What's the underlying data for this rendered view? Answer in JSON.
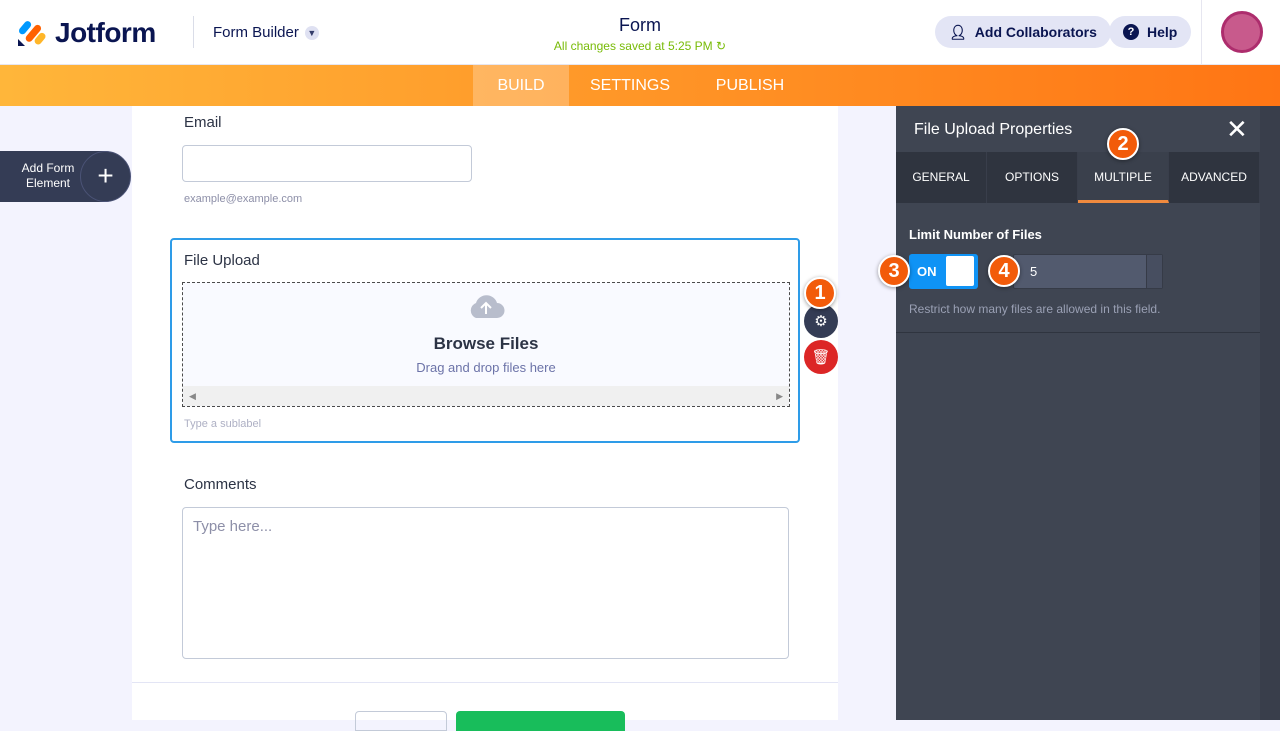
{
  "header": {
    "brand": "Jotform",
    "app_switch": "Form Builder",
    "form_title": "Form",
    "save_status": "All changes saved at 5:25 PM",
    "add_collaborators": "Add Collaborators",
    "help": "Help"
  },
  "nav": {
    "tabs": [
      {
        "label": "BUILD",
        "active": true
      },
      {
        "label": "SETTINGS"
      },
      {
        "label": "PUBLISH"
      }
    ]
  },
  "sidebar": {
    "add_element": "Add Form Element"
  },
  "form": {
    "email": {
      "label": "Email",
      "value": "",
      "sublabel": "example@example.com"
    },
    "file_upload": {
      "label": "File Upload",
      "browse": "Browse Files",
      "drag": "Drag and drop files here",
      "sublabel": "Type a sublabel"
    },
    "comments": {
      "label": "Comments",
      "placeholder": "Type here..."
    }
  },
  "properties": {
    "title": "File Upload Properties",
    "tabs": [
      "GENERAL",
      "OPTIONS",
      "MULTIPLE",
      "ADVANCED"
    ],
    "active_tab": "MULTIPLE",
    "limit_label": "Limit Number of Files",
    "toggle": "ON",
    "limit_value": "5",
    "help": "Restrict how many files are allowed in this field."
  },
  "annotations": [
    "1",
    "2",
    "3",
    "4"
  ],
  "colors": {
    "accent": "#ff7514",
    "upload_border": "#2e9ce8",
    "toggle": "#0f93f5",
    "badge": "#f25b0a"
  }
}
